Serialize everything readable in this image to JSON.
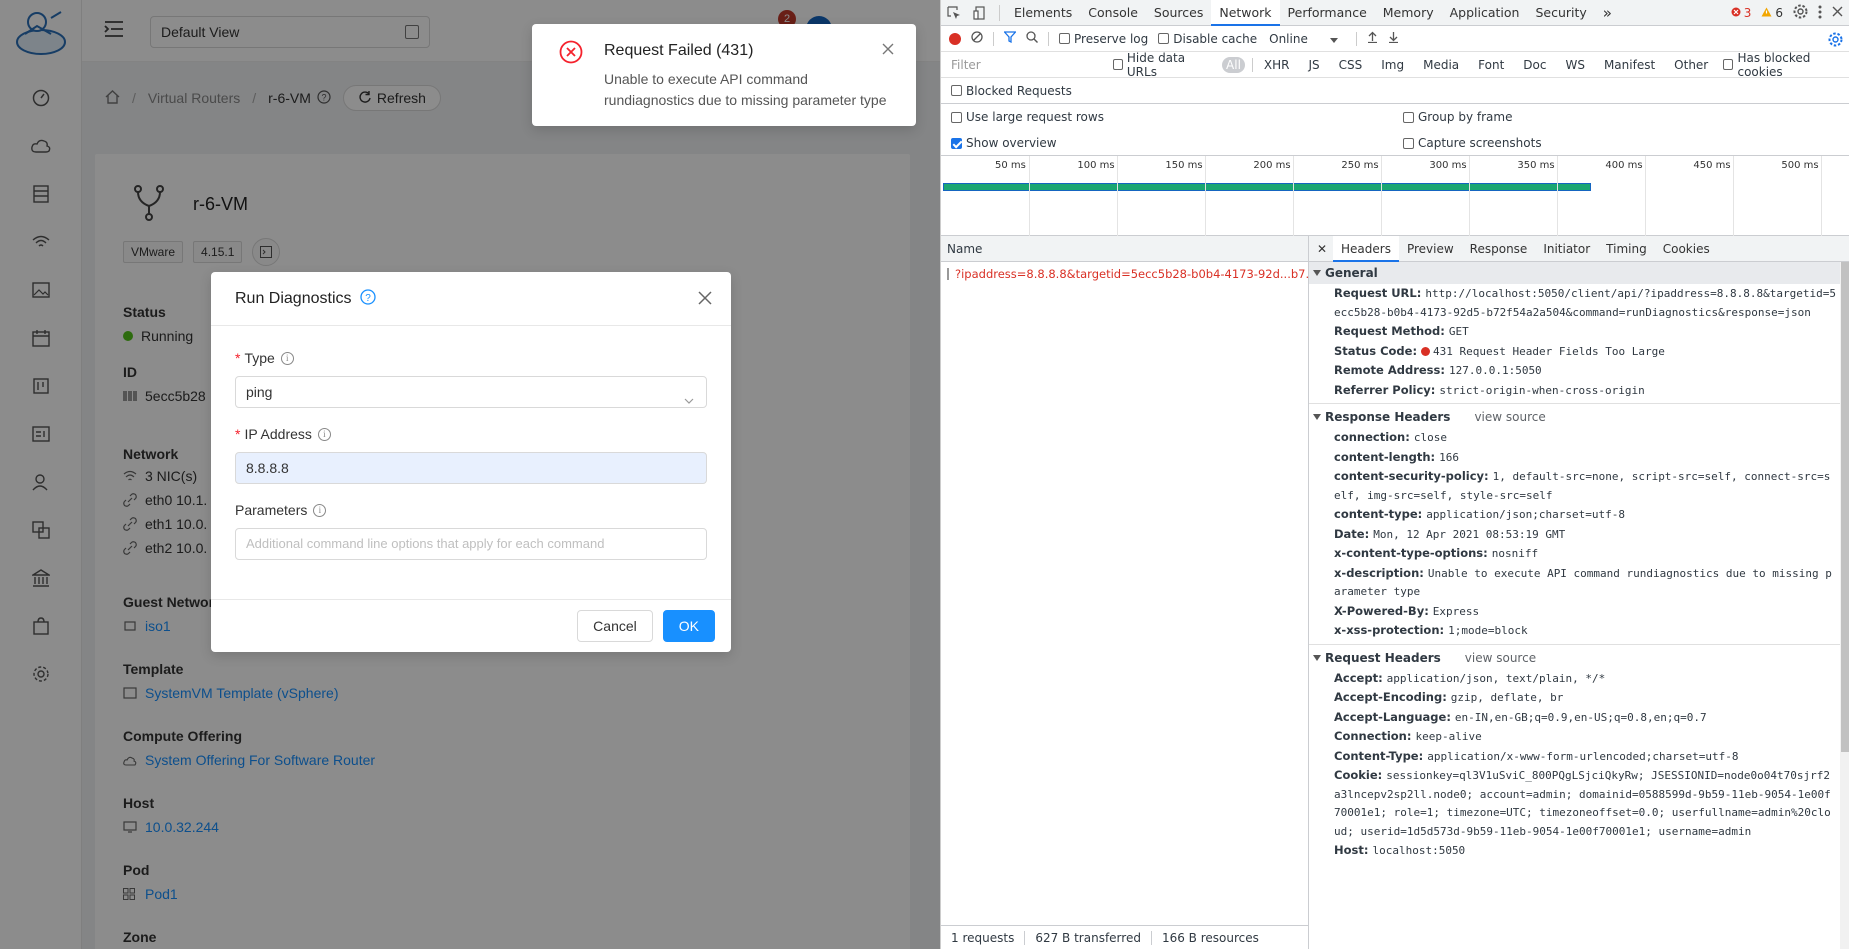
{
  "app": {
    "view_select": "Default View",
    "notification_badge": "2",
    "breadcrumb": {
      "home": "home",
      "section": "Virtual Routers",
      "current": "r-6-VM",
      "refresh": "Refresh"
    },
    "vm": {
      "name": "r-6-VM",
      "tags": [
        "VMware",
        "4.15.1"
      ],
      "status_label": "Status",
      "status_value": "Running",
      "id_label": "ID",
      "id_value": "5ecc5b28",
      "network_label": "Network",
      "nics": "3 NIC(s)",
      "eth0": "eth0 10.1.",
      "eth1": "eth1 10.0.",
      "eth2": "eth2 10.0.",
      "guest_network_label": "Guest Network",
      "guest_network_value": "iso1",
      "template_label": "Template",
      "template_value": "SystemVM Template (vSphere)",
      "compute_label": "Compute Offering",
      "compute_value": "System Offering For Software Router",
      "host_label": "Host",
      "host_value": "10.0.32.244",
      "pod_label": "Pod",
      "pod_value": "Pod1",
      "zone_label": "Zone"
    },
    "modal": {
      "title": "Run Diagnostics",
      "type_label": "Type",
      "type_value": "ping",
      "ip_label": "IP Address",
      "ip_value": "8.8.8.8",
      "params_label": "Parameters",
      "params_placeholder": "Additional command line options that apply for each command",
      "cancel": "Cancel",
      "ok": "OK"
    },
    "notification": {
      "title": "Request Failed (431)",
      "description": "Unable to execute API command rundiagnostics due to missing parameter type"
    }
  },
  "devtools": {
    "tabs": [
      "Elements",
      "Console",
      "Sources",
      "Network",
      "Performance",
      "Memory",
      "Application",
      "Security"
    ],
    "active_tab": "Network",
    "more": "»",
    "errors": "3",
    "warnings": "6",
    "toolbar": {
      "preserve_log": "Preserve log",
      "disable_cache": "Disable cache",
      "throttle": "Online"
    },
    "filter": {
      "placeholder": "Filter",
      "hide_data_urls": "Hide data URLs",
      "types": [
        "All",
        "XHR",
        "JS",
        "CSS",
        "Img",
        "Media",
        "Font",
        "Doc",
        "WS",
        "Manifest",
        "Other"
      ],
      "has_blocked_cookies": "Has blocked cookies"
    },
    "blocked_requests": "Blocked Requests",
    "options": {
      "large_rows": "Use large request rows",
      "group_by_frame": "Group by frame",
      "show_overview": "Show overview",
      "capture_screenshots": "Capture screenshots"
    },
    "overview_ticks": [
      "50 ms",
      "100 ms",
      "150 ms",
      "200 ms",
      "250 ms",
      "300 ms",
      "350 ms",
      "400 ms",
      "450 ms",
      "500 ms"
    ],
    "request_list": {
      "header": "Name",
      "row": "?ipaddress=8.8.8.8&targetid=5ecc5b28-b0b4-4173-92d...b7...",
      "status_requests": "1 requests",
      "status_transferred": "627 B transferred",
      "status_resources": "166 B resources"
    },
    "detail_tabs": [
      "Headers",
      "Preview",
      "Response",
      "Initiator",
      "Timing",
      "Cookies"
    ],
    "general": {
      "title": "General",
      "request_url_k": "Request URL:",
      "request_url_v": "http://localhost:5050/client/api/?ipaddress=8.8.8.8&targetid=5ecc5b28-b0b4-4173-92d5-b72f54a2a504&command=runDiagnostics&response=json",
      "method_k": "Request Method:",
      "method_v": "GET",
      "status_k": "Status Code:",
      "status_v": "431 Request Header Fields Too Large",
      "remote_k": "Remote Address:",
      "remote_v": "127.0.0.1:5050",
      "referrer_k": "Referrer Policy:",
      "referrer_v": "strict-origin-when-cross-origin"
    },
    "response_headers": {
      "title": "Response Headers",
      "view_source": "view source",
      "rows": [
        {
          "k": "connection:",
          "v": "close"
        },
        {
          "k": "content-length:",
          "v": "166"
        },
        {
          "k": "content-security-policy:",
          "v": "1, default-src=none, script-src=self, connect-src=self, img-src=self, style-src=self"
        },
        {
          "k": "content-type:",
          "v": "application/json;charset=utf-8"
        },
        {
          "k": "Date:",
          "v": "Mon, 12 Apr 2021 08:53:19 GMT"
        },
        {
          "k": "x-content-type-options:",
          "v": "nosniff"
        },
        {
          "k": "x-description:",
          "v": "Unable to execute API command rundiagnostics due to missing parameter type"
        },
        {
          "k": "X-Powered-By:",
          "v": "Express"
        },
        {
          "k": "x-xss-protection:",
          "v": "1;mode=block"
        }
      ]
    },
    "request_headers": {
      "title": "Request Headers",
      "view_source": "view source",
      "rows": [
        {
          "k": "Accept:",
          "v": "application/json, text/plain, */*"
        },
        {
          "k": "Accept-Encoding:",
          "v": "gzip, deflate, br"
        },
        {
          "k": "Accept-Language:",
          "v": "en-IN,en-GB;q=0.9,en-US;q=0.8,en;q=0.7"
        },
        {
          "k": "Connection:",
          "v": "keep-alive"
        },
        {
          "k": "Content-Type:",
          "v": "application/x-www-form-urlencoded;charset=utf-8"
        },
        {
          "k": "Cookie:",
          "v": "sessionkey=ql3V1uSviC_800PQgLSjciQkyRw; JSESSIONID=node0o04t70sjrf2a3lncepv2sp2ll.node0; account=admin; domainid=0588599d-9b59-11eb-9054-1e00f70001e1; role=1; timezone=UTC; timezoneoffset=0.0; userfullname=admin%20cloud; userid=1d5d573d-9b59-11eb-9054-1e00f70001e1; username=admin"
        },
        {
          "k": "Host:",
          "v": "localhost:5050"
        }
      ]
    }
  }
}
